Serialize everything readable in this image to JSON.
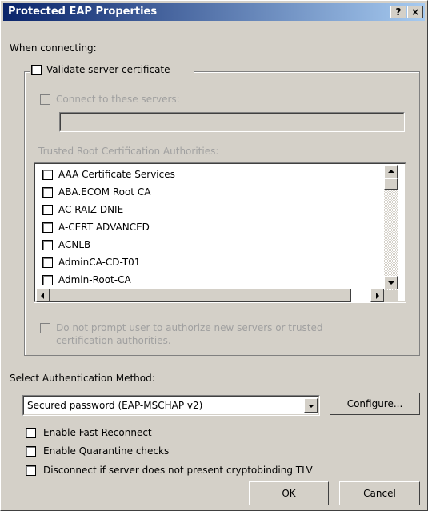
{
  "window": {
    "title": "Protected EAP Properties",
    "help_label": "?",
    "close_label": "×"
  },
  "when_connecting": "When connecting:",
  "validate_cert": {
    "label": "Validate server certificate",
    "checked": false
  },
  "connect_servers": {
    "label": "Connect to these servers:",
    "value": ""
  },
  "trusted_root_label": "Trusted Root Certification Authorities:",
  "ca_list": [
    "AAA Certificate Services",
    "ABA.ECOM Root CA",
    "AC RAIZ DNIE",
    "A-CERT ADVANCED",
    "ACNLB",
    "AdminCA-CD-T01",
    "Admin-Root-CA"
  ],
  "no_prompt": {
    "line1": "Do not prompt user to authorize new servers or trusted",
    "line2": "certification authorities."
  },
  "auth_method": {
    "label": "Select Authentication Method:",
    "selected": "Secured password (EAP-MSCHAP v2)",
    "configure_label": "Configure..."
  },
  "options": [
    {
      "label": "Enable Fast Reconnect",
      "checked": false
    },
    {
      "label": "Enable Quarantine checks",
      "checked": false
    },
    {
      "label": "Disconnect if server does not present cryptobinding TLV",
      "checked": false
    }
  ],
  "buttons": {
    "ok": "OK",
    "cancel": "Cancel"
  },
  "colors": {
    "titlebar_start": "#0a246a",
    "titlebar_end": "#a6caf0",
    "face": "#d4d0c8"
  }
}
